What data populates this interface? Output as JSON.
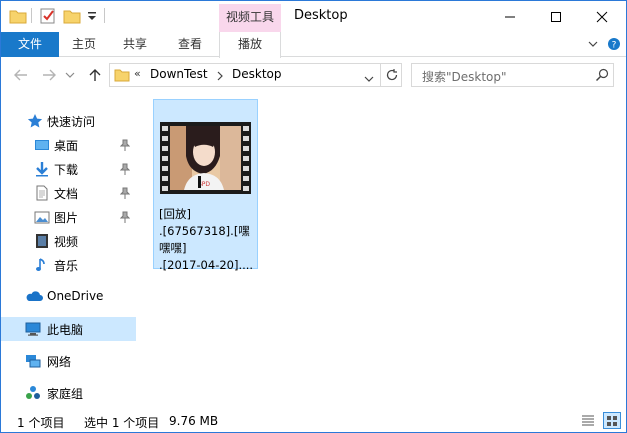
{
  "window": {
    "title": "Desktop",
    "context_tab_header": "视频工具"
  },
  "ribbon": {
    "tabs": [
      {
        "label": "文件"
      },
      {
        "label": "主页"
      },
      {
        "label": "共享"
      },
      {
        "label": "查看"
      },
      {
        "label": "播放"
      }
    ]
  },
  "address": {
    "overflow": "«",
    "crumbs": [
      "DownTest",
      "Desktop"
    ]
  },
  "search": {
    "placeholder": "搜索\"Desktop\""
  },
  "nav": {
    "items": [
      {
        "label": "快速访问",
        "icon": "star-icon"
      },
      {
        "label": "桌面",
        "icon": "desktop-icon",
        "pinned": true
      },
      {
        "label": "下载",
        "icon": "download-icon",
        "pinned": true
      },
      {
        "label": "文档",
        "icon": "document-icon",
        "pinned": true
      },
      {
        "label": "图片",
        "icon": "pictures-icon",
        "pinned": true
      },
      {
        "label": "视频",
        "icon": "video-icon"
      },
      {
        "label": "音乐",
        "icon": "music-icon"
      },
      {
        "label": "OneDrive",
        "icon": "onedrive-icon"
      },
      {
        "label": "此电脑",
        "icon": "computer-icon",
        "selected": true
      },
      {
        "label": "网络",
        "icon": "network-icon"
      },
      {
        "label": "家庭组",
        "icon": "homegroup-icon"
      }
    ]
  },
  "files": [
    {
      "name_lines": [
        "[回放]",
        ".[67567318].[嘿",
        "嘿嘿]",
        ".[2017-04-20]...."
      ],
      "selected": true,
      "icon": "video-thumbnail-icon"
    }
  ],
  "status": {
    "count": "1 个项目",
    "selection": "选中 1 个项目",
    "size": "9.76 MB"
  },
  "colors": {
    "accent": "#1979ca",
    "selection": "#cce8ff",
    "selection_border": "#99d1ff",
    "context_tab": "#f9d7ec"
  }
}
